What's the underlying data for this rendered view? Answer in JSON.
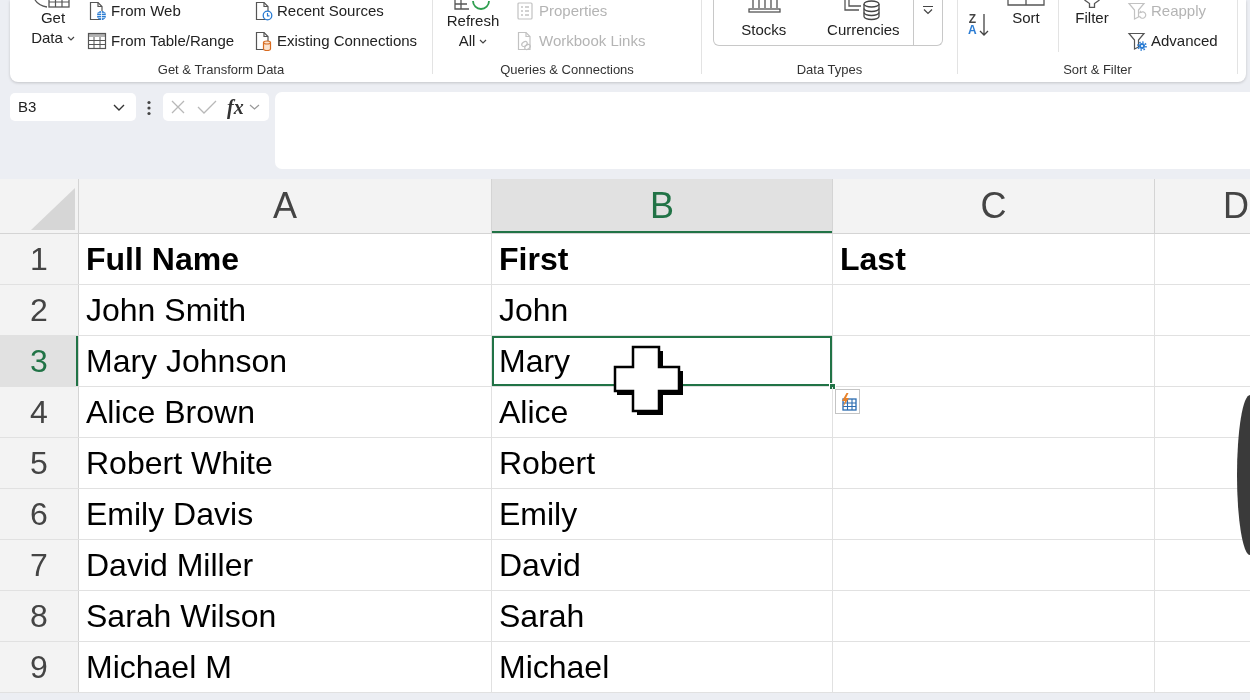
{
  "ribbon": {
    "groups": [
      {
        "label": "Get & Transform Data",
        "items": [
          {
            "kind": "large",
            "label": "Get Data",
            "dropdown": true
          },
          {
            "kind": "stack",
            "buttons": [
              {
                "label": "From Web",
                "disabled": false
              },
              {
                "label": "From Table/Range",
                "disabled": false
              }
            ]
          },
          {
            "kind": "stack",
            "buttons": [
              {
                "label": "Recent Sources",
                "disabled": false
              },
              {
                "label": "Existing Connections",
                "disabled": false
              }
            ]
          }
        ]
      },
      {
        "label": "Queries & Connections",
        "items": [
          {
            "kind": "large",
            "label": "Refresh All",
            "dropdown": true
          },
          {
            "kind": "stack",
            "buttons": [
              {
                "label": "Properties",
                "disabled": true
              },
              {
                "label": "Workbook Links",
                "disabled": true
              }
            ]
          }
        ]
      },
      {
        "label": "Data Types",
        "items": [
          {
            "kind": "gallery",
            "options": [
              {
                "label": "Stocks"
              },
              {
                "label": "Currencies"
              }
            ]
          }
        ]
      },
      {
        "label": "Sort & Filter",
        "items": [
          {
            "kind": "sort",
            "letters": [
              "Z",
              "A"
            ]
          },
          {
            "kind": "large",
            "label": "Sort",
            "dropdown": false
          },
          {
            "kind": "separator"
          },
          {
            "kind": "large",
            "label": "Filter",
            "dropdown": false
          },
          {
            "kind": "stack",
            "buttons": [
              {
                "label": "Reapply",
                "disabled": true
              },
              {
                "label": "Advanced",
                "disabled": false
              }
            ]
          }
        ]
      }
    ]
  },
  "formula_bar": {
    "name_box": "B3",
    "function_button": "fx"
  },
  "sheet": {
    "columns": [
      {
        "label": "A",
        "selected": false
      },
      {
        "label": "B",
        "selected": true
      },
      {
        "label": "C",
        "selected": false
      },
      {
        "label": "D",
        "selected": false
      }
    ],
    "rows": [
      {
        "number": "1",
        "selected": false,
        "bold": true,
        "cells": [
          {
            "text": "Full Name",
            "selected": false
          },
          {
            "text": "First",
            "selected": false
          },
          {
            "text": "Last",
            "selected": false
          }
        ]
      },
      {
        "number": "2",
        "selected": false,
        "bold": false,
        "cells": [
          {
            "text": "John Smith",
            "selected": false
          },
          {
            "text": "John",
            "selected": false
          }
        ]
      },
      {
        "number": "3",
        "selected": true,
        "bold": false,
        "cells": [
          {
            "text": "Mary Johnson",
            "selected": false
          },
          {
            "text": "Mary",
            "selected": true
          }
        ]
      },
      {
        "number": "4",
        "selected": false,
        "bold": false,
        "cells": [
          {
            "text": "Alice Brown",
            "selected": false
          },
          {
            "text": "Alice",
            "selected": false
          }
        ]
      },
      {
        "number": "5",
        "selected": false,
        "bold": false,
        "cells": [
          {
            "text": "Robert White",
            "selected": false
          },
          {
            "text": "Robert",
            "selected": false
          }
        ]
      },
      {
        "number": "6",
        "selected": false,
        "bold": false,
        "cells": [
          {
            "text": "Emily Davis",
            "selected": false
          },
          {
            "text": "Emily",
            "selected": false
          }
        ]
      },
      {
        "number": "7",
        "selected": false,
        "bold": false,
        "cells": [
          {
            "text": "David Miller",
            "selected": false
          },
          {
            "text": "David",
            "selected": false
          }
        ]
      },
      {
        "number": "8",
        "selected": false,
        "bold": false,
        "cells": [
          {
            "text": "Sarah Wilson",
            "selected": false
          },
          {
            "text": "Sarah",
            "selected": false
          }
        ]
      },
      {
        "number": "9",
        "selected": false,
        "bold": false,
        "cells": [
          {
            "text": "Michael M",
            "selected": false
          },
          {
            "text": "Michael",
            "selected": false
          }
        ]
      }
    ]
  }
}
